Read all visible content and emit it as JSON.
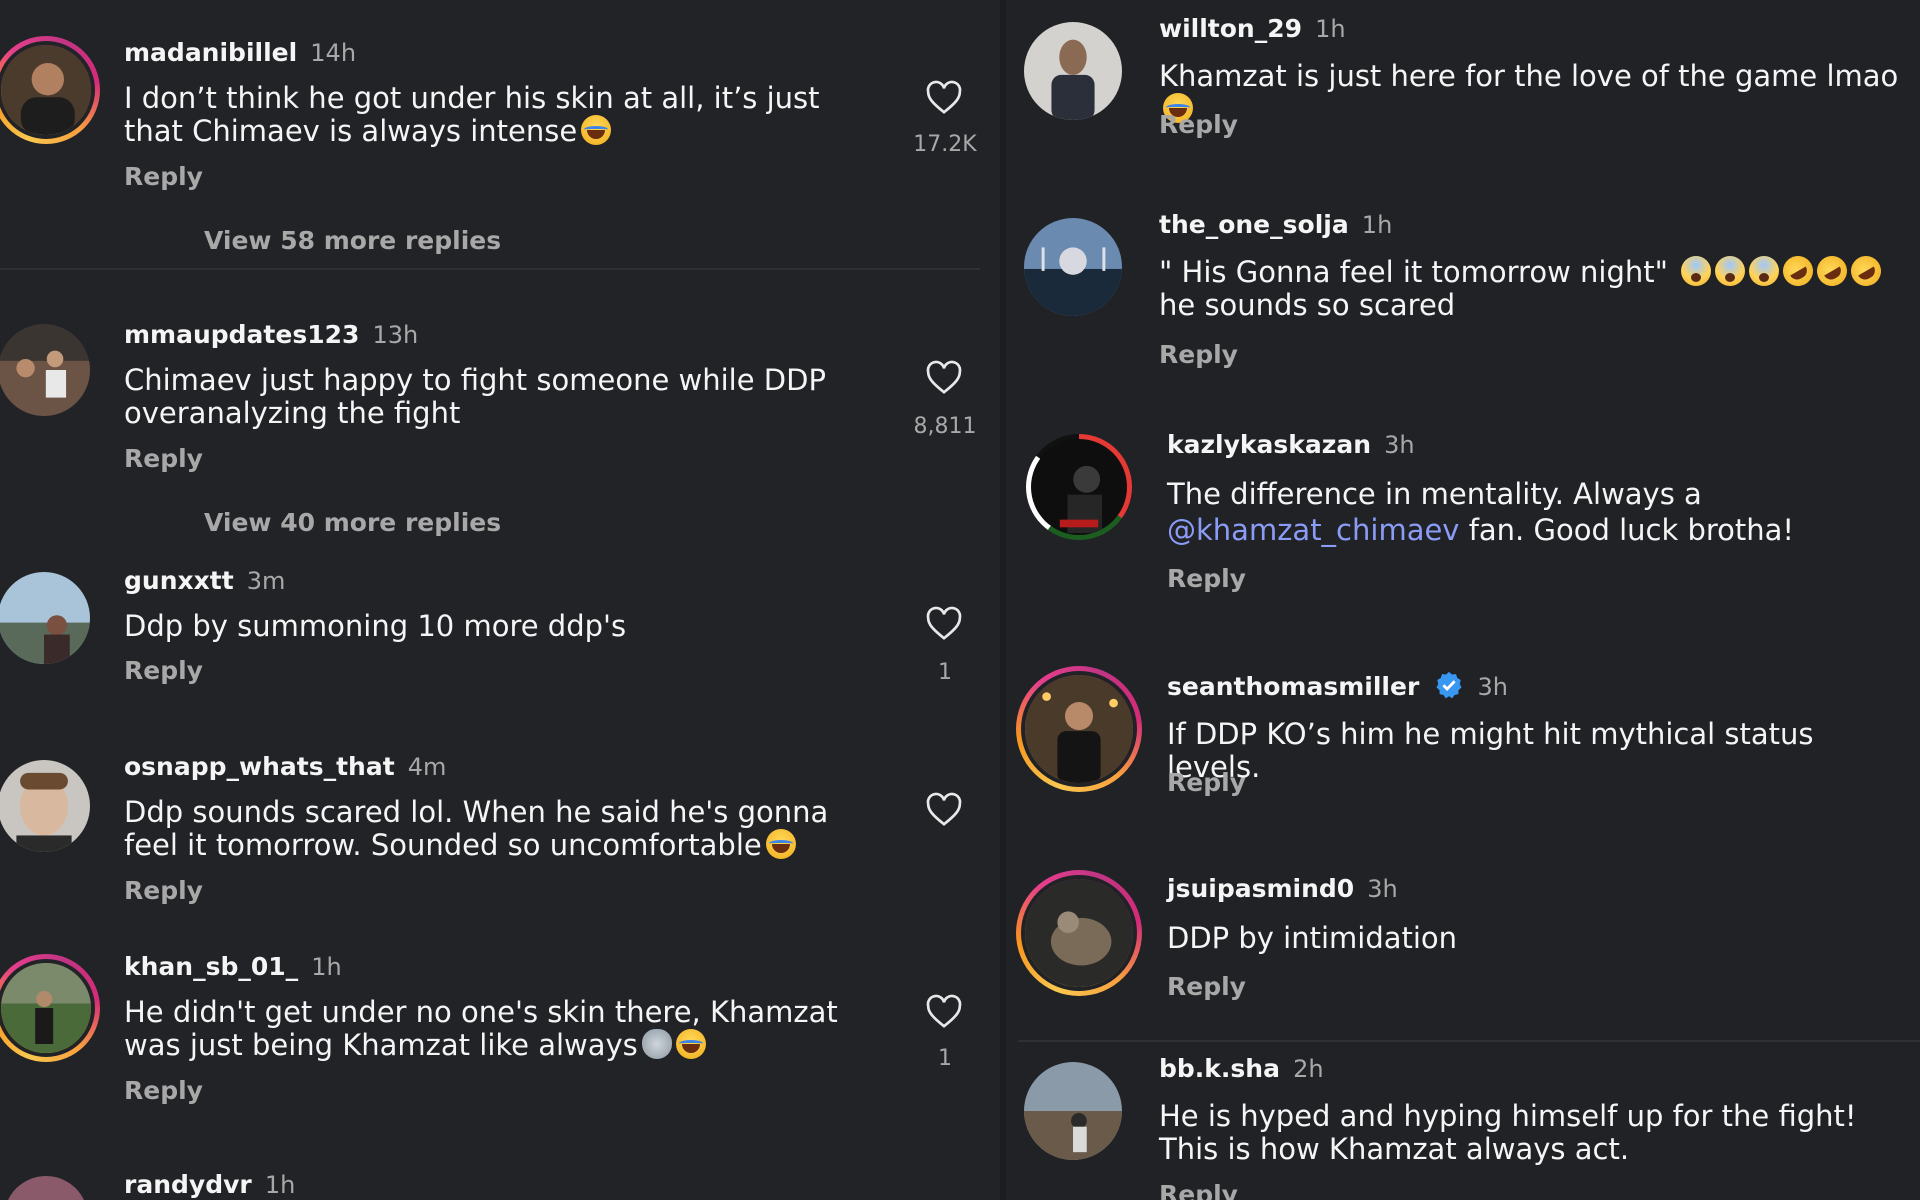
{
  "left_column": {
    "comments": [
      {
        "username": "madanibillel",
        "time": "14h",
        "text": "I don’t think he got under his skin at all, it’s just that Chimaev is always intense",
        "like_count": "17.2K",
        "reply_label": "Reply",
        "view_more_label": "View 58 more replies",
        "emojis": [
          "face-with-tears-of-joy"
        ]
      },
      {
        "username": "mmaupdates123",
        "time": "13h",
        "text": "Chimaev just happy to fight someone while DDP overanalyzing the fight",
        "like_count": "8,811",
        "reply_label": "Reply",
        "view_more_label": "View 40 more replies"
      },
      {
        "username": "gunxxtt",
        "time": "3m",
        "text": "Ddp by summoning 10 more ddp's",
        "like_count": "1",
        "reply_label": "Reply"
      },
      {
        "username": "osnapp_whats_that",
        "time": "4m",
        "text": "Ddp sounds scared lol. When he said he's gonna feel it tomorrow.  Sounded so uncomfortable",
        "reply_label": "Reply",
        "emojis": [
          "face-with-tears-of-joy"
        ]
      },
      {
        "username": "khan_sb_01_",
        "time": "1h",
        "text": "He didn't get under no one's skin there, Khamzat was just being Khamzat like always",
        "like_count": "1",
        "reply_label": "Reply",
        "emojis": [
          "wolf-face",
          "face-with-tears-of-joy"
        ]
      },
      {
        "username": "randydvr",
        "time": "1h"
      }
    ]
  },
  "right_column": {
    "comments": [
      {
        "username": "willton_29",
        "time": "1h",
        "text": "Khamzat is just here for the love of the game lmao",
        "reply_label": "Reply",
        "emojis": [
          "face-with-tears-of-joy"
        ]
      },
      {
        "username": "the_one_solja",
        "time": "1h",
        "text_start": "\" His Gonna feel it tomorrow night\"",
        "text_end": "he sounds so scared",
        "reply_label": "Reply",
        "emojis": [
          "fearful-face",
          "fearful-face",
          "fearful-face",
          "rolling-on-the-floor-laughing",
          "rolling-on-the-floor-laughing",
          "rolling-on-the-floor-laughing"
        ]
      },
      {
        "username": "kazlykaskazan",
        "time": "3h",
        "text_before": "The difference in mentality. Always a",
        "mention": "@khamzat_chimaev",
        "text_after": "fan. Good luck brotha!",
        "reply_label": "Reply"
      },
      {
        "username": "seanthomasmiller",
        "time": "3h",
        "verified": true,
        "text": "If DDP KO’s him he might hit mythical status levels.",
        "reply_label": "Reply"
      },
      {
        "username": "jsuipasmind0",
        "time": "3h",
        "text": "DDP by intimidation",
        "reply_label": "Reply"
      },
      {
        "username": "bb.k.sha",
        "time": "2h",
        "text": "He is hyped and hyping himself up for the fight! This is how Khamzat always act.",
        "reply_label": "Reply"
      }
    ]
  },
  "colors": {
    "background": "#202124",
    "text_primary": "#f5f5f5",
    "text_secondary": "#a8a8a8",
    "mention": "#8b9cf7",
    "verified_badge": "#3897f0"
  },
  "icons": {
    "like": "heart-outline-icon",
    "verified": "verified-badge-icon"
  }
}
